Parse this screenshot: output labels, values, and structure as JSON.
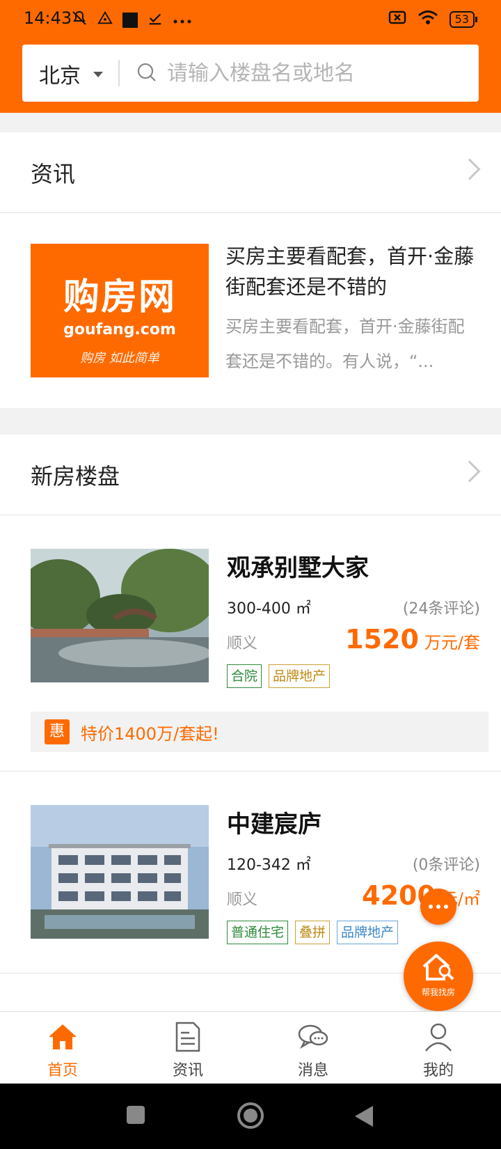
{
  "status_bar": {
    "time": "14:43",
    "battery": "53",
    "icons": [
      "mute-icon",
      "alert-icon",
      "square-icon",
      "check-icon",
      "more-icon",
      "sim-icon",
      "wifi-icon",
      "battery-icon"
    ]
  },
  "header": {
    "city": "北京",
    "search_placeholder": "请输入楼盘名或地名"
  },
  "news_section": {
    "title": "资讯",
    "item": {
      "thumb_line1": "购房网",
      "thumb_line2": "goufang.com",
      "thumb_line3": "购房 如此简单",
      "title": "买房主要看配套，首开·金藤街配套还是不错的",
      "desc": "买房主要看配套，首开·金藤街配套还是不错的。有人说，“..."
    }
  },
  "new_homes_section": {
    "title": "新房楼盘",
    "properties": [
      {
        "name": "观承别墅大家",
        "area": "300-400 ㎡",
        "reviews": "(24条评论)",
        "district": "顺义",
        "price": "1520",
        "price_unit": "万元/套",
        "tags": [
          {
            "text": "合院",
            "color": "green"
          },
          {
            "text": "品牌地产",
            "color": "gold"
          }
        ],
        "promo_badge": "惠",
        "promo_text": "特价1400万/套起!"
      },
      {
        "name": "中建宸庐",
        "area": "120-342 ㎡",
        "reviews": "(0条评论)",
        "district": "顺义",
        "price": "4200",
        "price_unit": "元/㎡",
        "tags": [
          {
            "text": "普通住宅",
            "color": "green"
          },
          {
            "text": "叠拼",
            "color": "gold"
          },
          {
            "text": "品牌地产",
            "color": "blue"
          }
        ]
      }
    ]
  },
  "float": {
    "find_label": "帮我找房"
  },
  "tabbar": {
    "items": [
      {
        "label": "首页",
        "active": true
      },
      {
        "label": "资讯",
        "active": false
      },
      {
        "label": "消息",
        "active": false
      },
      {
        "label": "我的",
        "active": false
      }
    ]
  },
  "colors": {
    "brand": "#ff6a00",
    "tag_green": "#2e8b3a",
    "tag_gold": "#c08a14",
    "tag_blue": "#3a86c8"
  }
}
